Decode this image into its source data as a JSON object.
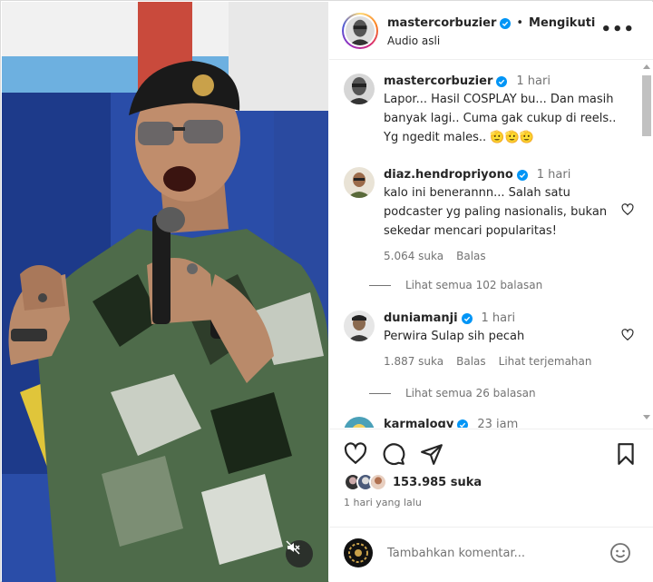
{
  "header": {
    "username": "mastercorbuzier",
    "separator": "•",
    "follow_label": "Mengikuti",
    "audio": "Audio asli",
    "more_glyph": "•••"
  },
  "comments": [
    {
      "username": "mastercorbuzier",
      "time": "1 hari",
      "text": "Lapor... Hasil COSPLAY bu... Dan masih banyak lagi.. Cuma gak cukup di reels.. Yg ngedit males.. 🫡🫡🫡",
      "verified": true
    },
    {
      "username": "diaz.hendropriyono",
      "time": "1 hari",
      "text": "kalo ini benerannn... Salah satu podcaster yg paling nasionalis, bukan sekedar mencari popularitas!",
      "likes": "5.064 suka",
      "reply": "Balas",
      "view_replies": "Lihat semua 102 balasan",
      "verified": true
    },
    {
      "username": "duniamanji",
      "time": "1 hari",
      "text": "Perwira Sulap sih pecah",
      "likes": "1.887 suka",
      "reply": "Balas",
      "translate": "Lihat terjemahan",
      "view_replies": "Lihat semua 26 balasan",
      "verified": true
    },
    {
      "username": "karmalogy",
      "time": "23 jam",
      "verified": true
    }
  ],
  "post": {
    "likes": "153.985 suka",
    "date": "1 hari yang lalu"
  },
  "add_comment": {
    "placeholder": "Tambahkan komentar..."
  },
  "colors": {
    "verified": "#0095f6",
    "text": "#262626",
    "muted": "#737373",
    "border": "#efefef"
  },
  "icons": [
    "heart-icon",
    "comment-icon",
    "share-icon",
    "bookmark-icon",
    "emoji-icon",
    "mute-icon",
    "more-icon",
    "verified-icon"
  ]
}
